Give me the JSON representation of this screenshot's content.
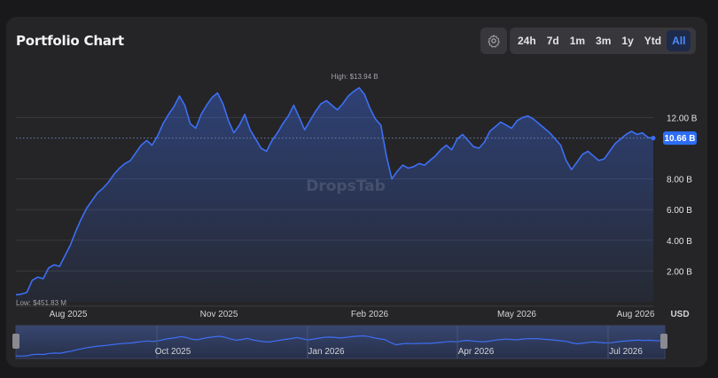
{
  "header": {
    "title": "Portfolio Chart",
    "ranges": [
      {
        "label": "24h",
        "active": false
      },
      {
        "label": "7d",
        "active": false
      },
      {
        "label": "1m",
        "active": false
      },
      {
        "label": "3m",
        "active": false
      },
      {
        "label": "1y",
        "active": false
      },
      {
        "label": "Ytd",
        "active": false
      },
      {
        "label": "All",
        "active": true
      }
    ],
    "settings_icon": "gear-icon"
  },
  "colors": {
    "line": "#3d6ff5",
    "accent": "#2d6df6",
    "card": "#252527"
  },
  "chart_data": {
    "type": "area",
    "watermark": "DropsTab",
    "y_unit": "USD",
    "ylim": [
      0,
      14.8
    ],
    "yticks": [
      {
        "value": 2,
        "label": "2.00 B"
      },
      {
        "value": 4,
        "label": "4.00 B"
      },
      {
        "value": 6,
        "label": "6.00 B"
      },
      {
        "value": 8,
        "label": "8.00 B"
      },
      {
        "value": 12,
        "label": "12.00 B"
      }
    ],
    "x_ticks": [
      "Aug 2025",
      "Nov 2025",
      "Feb 2026",
      "May 2026",
      "Aug 2026"
    ],
    "high_label": "High: $13.94 B",
    "low_label": "Low: $451.83 M",
    "current_label": "10.66 B",
    "current_value": 10.66,
    "series": [
      {
        "values": [
          0.45,
          0.5,
          0.6,
          1.4,
          1.6,
          1.5,
          2.2,
          2.4,
          2.3,
          3.0,
          3.7,
          4.6,
          5.4,
          6.1,
          6.6,
          7.1,
          7.4,
          7.8,
          8.3,
          8.7,
          9.0,
          9.2,
          9.7,
          10.2,
          10.5,
          10.2,
          10.8,
          11.6,
          12.2,
          12.7,
          13.4,
          12.8,
          11.6,
          11.3,
          12.2,
          12.8,
          13.3,
          13.6,
          12.9,
          11.8,
          11.0,
          11.5,
          12.2,
          11.2,
          10.6,
          10.0,
          9.8,
          10.5,
          11.0,
          11.6,
          12.1,
          12.8,
          12.0,
          11.2,
          11.8,
          12.4,
          12.9,
          13.1,
          12.8,
          12.5,
          12.9,
          13.4,
          13.7,
          13.94,
          13.5,
          12.6,
          11.9,
          11.5,
          9.5,
          8.0,
          8.5,
          8.9,
          8.7,
          8.8,
          9.0,
          8.9,
          9.2,
          9.5,
          9.9,
          10.2,
          9.9,
          10.6,
          10.9,
          10.5,
          10.1,
          10.0,
          10.4,
          11.1,
          11.4,
          11.7,
          11.5,
          11.3,
          11.8,
          12.0,
          12.1,
          11.9,
          11.6,
          11.3,
          11.0,
          10.6,
          10.2,
          9.2,
          8.6,
          9.1,
          9.6,
          9.8,
          9.5,
          9.2,
          9.3,
          9.8,
          10.3,
          10.6,
          10.9,
          11.1,
          10.9,
          11.0,
          10.7,
          10.66
        ]
      }
    ],
    "navigator": {
      "x_ticks": [
        "Oct 2025",
        "Jan 2026",
        "Apr 2026",
        "Jul 2026"
      ]
    }
  }
}
